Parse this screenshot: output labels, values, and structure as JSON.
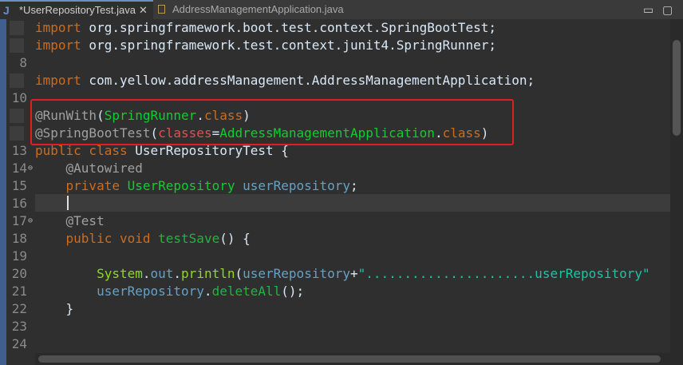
{
  "tabs": {
    "active": {
      "icon": "J",
      "label": "*UserRepositoryTest.java",
      "close": "✕"
    },
    "inactive": {
      "label": "AddressManagementApplication.java"
    }
  },
  "window": {
    "minimize": "▭",
    "maximize": "▢"
  },
  "editor": {
    "lines": [
      {
        "num": "",
        "tokens": [
          [
            "kw",
            "import"
          ],
          [
            "plain",
            " org.springframework.boot.test.context.SpringBootTest;"
          ]
        ]
      },
      {
        "num": "",
        "tokens": [
          [
            "kw",
            "import"
          ],
          [
            "plain",
            " org.springframework.test.context.junit4.SpringRunner;"
          ]
        ]
      },
      {
        "num": "8",
        "tokens": []
      },
      {
        "num": "",
        "tokens": [
          [
            "kw",
            "import"
          ],
          [
            "plain",
            " com.yellow.addressManagement.AddressManagementApplication;"
          ]
        ]
      },
      {
        "num": "10",
        "tokens": []
      },
      {
        "num": "",
        "tokens": [
          [
            "ann",
            "@RunWith"
          ],
          [
            "plain",
            "("
          ],
          [
            "type",
            "SpringRunner"
          ],
          [
            "plain",
            "."
          ],
          [
            "kw",
            "class"
          ],
          [
            "plain",
            ")"
          ]
        ]
      },
      {
        "num": "",
        "tokens": [
          [
            "ann",
            "@SpringBootTest"
          ],
          [
            "plain",
            "("
          ],
          [
            "attr",
            "classes"
          ],
          [
            "plain",
            "="
          ],
          [
            "type",
            "AddressManagementApplication"
          ],
          [
            "plain",
            "."
          ],
          [
            "kw",
            "class"
          ],
          [
            "plain",
            ")"
          ]
        ]
      },
      {
        "num": "13",
        "tokens": [
          [
            "kw",
            "public class"
          ],
          [
            "plain",
            " UserRepositoryTest {"
          ]
        ]
      },
      {
        "num": "14",
        "tokens": [
          [
            "plain",
            "    "
          ],
          [
            "ann",
            "@Autowired"
          ]
        ]
      },
      {
        "num": "15",
        "tokens": [
          [
            "plain",
            "    "
          ],
          [
            "kw",
            "private"
          ],
          [
            "plain",
            " "
          ],
          [
            "type",
            "UserRepository"
          ],
          [
            "plain",
            " "
          ],
          [
            "field",
            "userRepository"
          ],
          [
            "plain",
            ";"
          ]
        ]
      },
      {
        "num": "16",
        "tokens": []
      },
      {
        "num": "17",
        "tokens": [
          [
            "plain",
            "    "
          ],
          [
            "ann",
            "@Test"
          ]
        ]
      },
      {
        "num": "18",
        "tokens": [
          [
            "plain",
            "    "
          ],
          [
            "kw",
            "public void"
          ],
          [
            "plain",
            " "
          ],
          [
            "method",
            "testSave"
          ],
          [
            "plain",
            "() {"
          ]
        ]
      },
      {
        "num": "19",
        "tokens": []
      },
      {
        "num": "20",
        "tokens": [
          [
            "plain",
            "        "
          ],
          [
            "sysout",
            "System"
          ],
          [
            "plain",
            "."
          ],
          [
            "field",
            "out"
          ],
          [
            "plain",
            "."
          ],
          [
            "sysout",
            "println"
          ],
          [
            "plain",
            "("
          ],
          [
            "field",
            "userRepository"
          ],
          [
            "plain",
            "+"
          ],
          [
            "str",
            "\"......................userRepository\""
          ]
        ]
      },
      {
        "num": "21",
        "tokens": [
          [
            "plain",
            "        "
          ],
          [
            "field",
            "userRepository"
          ],
          [
            "plain",
            "."
          ],
          [
            "method",
            "deleteAll"
          ],
          [
            "plain",
            "();"
          ]
        ]
      },
      {
        "num": "22",
        "tokens": [
          [
            "plain",
            "    }"
          ]
        ]
      },
      {
        "num": "23",
        "tokens": []
      },
      {
        "num": "24",
        "tokens": []
      }
    ],
    "fold_markers": {
      "14": "⊖",
      "17": "⊖"
    }
  }
}
